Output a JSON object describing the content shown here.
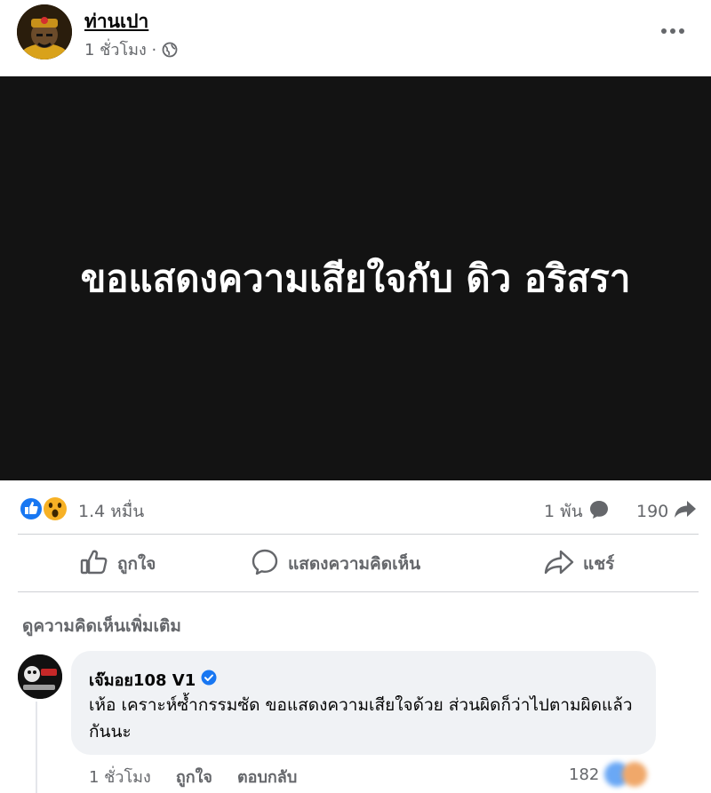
{
  "post": {
    "author_name": "ท่านเปา",
    "time": "1 ชั่วโมง ·",
    "privacy_icon": "globe-icon",
    "more_icon": "more-horizontal-icon",
    "image_text": "ขอแสดงความเสียใจกับ ดิว อริสรา"
  },
  "reactions": {
    "icons": [
      "like-icon",
      "wow-icon"
    ],
    "count": "1.4 หมื่น",
    "comments_count": "1 พัน",
    "shares_count": "190"
  },
  "actions": {
    "like_label": "ถูกใจ",
    "comment_label": "แสดงความคิดเห็น",
    "share_label": "แชร์"
  },
  "more_comments_label": "ดูความคิดเห็นเพิ่มเติม",
  "comment": {
    "author_name": "เจ๊มอย108 V1",
    "text": "เห้อ เคราะห์ซ้ำกรรมซัด ขอแสดงความเสียใจด้วย ส่วนผิดก็ว่าไปตามผิดแล้วกันนะ",
    "time": "1 ชั่วโมง",
    "like_label": "ถูกใจ",
    "reply_label": "ตอบกลับ",
    "reaction_count": "182"
  },
  "colors": {
    "like_blue": "#1877f2",
    "verified_blue": "#1877f2",
    "secondary_text": "#65676b",
    "image_bg": "#131313"
  }
}
